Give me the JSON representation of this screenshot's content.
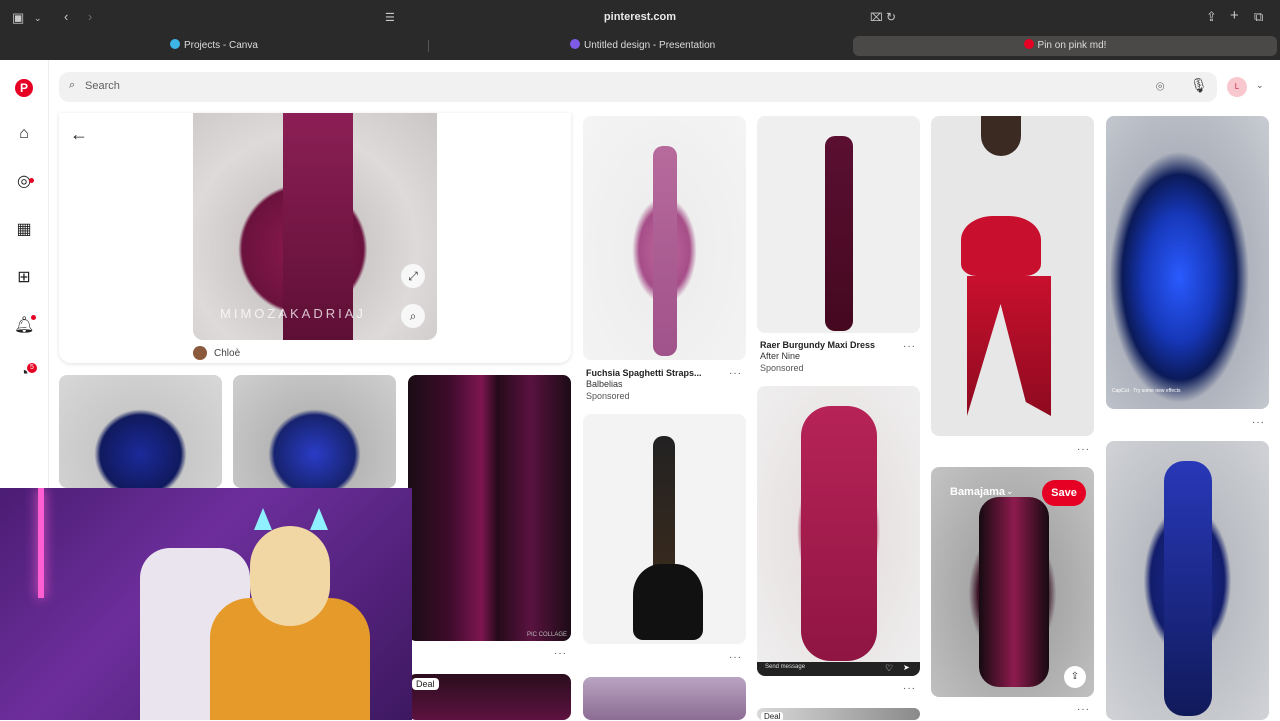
{
  "browser": {
    "url": "pinterest.com",
    "tabs": [
      {
        "label": "Projects - Canva",
        "color": "#3db5e6"
      },
      {
        "label": "Untitled design - Presentation",
        "color": "#7d5be6"
      },
      {
        "label": "Pin on pink md!",
        "color": "#e60023"
      }
    ]
  },
  "search": {
    "placeholder": "Search"
  },
  "user": {
    "initial": "L"
  },
  "sidebar": {
    "message_badge": "5"
  },
  "closeup": {
    "watermark": "MIMOZAKADRIAJ",
    "author": "Chloè"
  },
  "pins": {
    "fuchsia": {
      "title": "Fuchsia Spaghetti Straps...",
      "sub": "Balbelias",
      "sponsored": "Sponsored"
    },
    "raer": {
      "title": "Raer Burgundy Maxi Dress",
      "sub": "After Nine",
      "sponsored": "Sponsored"
    },
    "hover": {
      "board": "Bamajama",
      "save": "Save"
    },
    "deal_label": "Deal",
    "deal_label_2": "Deal",
    "capcut_text": "CapCut · Try some new effects",
    "send_message": "Send message",
    "pic_collage": "PIC COLLAGE"
  },
  "colors": {
    "brand": "#e60023",
    "chrome": "#2b2a2a"
  }
}
